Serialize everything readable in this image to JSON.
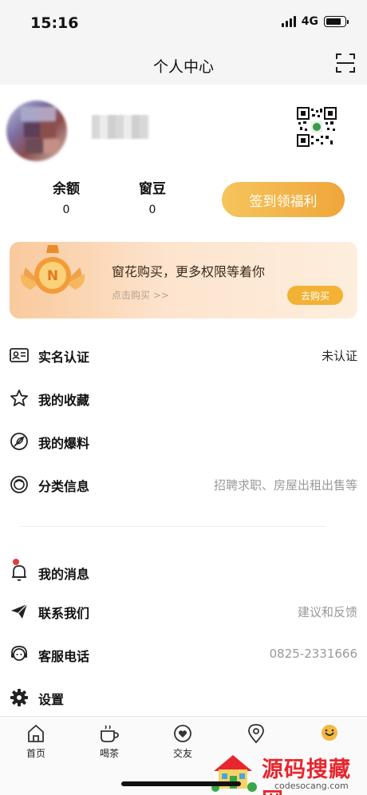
{
  "status_bar": {
    "time": "15:16",
    "network": "4G"
  },
  "header": {
    "title": "个人中心",
    "scan_icon": "scan-icon"
  },
  "profile": {
    "avatar_icon": "avatar-blurred",
    "username_icon": "username-blurred",
    "qr_icon": "qr-code-icon"
  },
  "stats": [
    {
      "label": "余额",
      "value": "0"
    },
    {
      "label": "窗豆",
      "value": "0"
    }
  ],
  "signin_button": "签到领福利",
  "vip_card": {
    "title": "窗花购买，更多权限等着你",
    "subtitle": "点击购买 >>",
    "button": "去购买",
    "medal_letter": "N"
  },
  "menu": [
    {
      "label": "实名认证",
      "value": "未认证",
      "icon": "id-card-icon"
    },
    {
      "label": "我的收藏",
      "value": "",
      "icon": "star-icon"
    },
    {
      "label": "我的爆料",
      "value": "",
      "icon": "leaf-icon"
    },
    {
      "label": "分类信息",
      "value": "招聘求职、房屋出租出售等",
      "icon": "circle-icon"
    },
    {
      "label": "我的消息",
      "value": "",
      "icon": "bell-icon"
    },
    {
      "label": "联系我们",
      "value": "建议和反馈",
      "icon": "paper-plane-icon"
    },
    {
      "label": "客服电话",
      "value": "0825-2331666",
      "icon": "headset-icon"
    },
    {
      "label": "设置",
      "value": "",
      "icon": "gear-icon"
    }
  ],
  "tabs": [
    {
      "label": "首页",
      "icon": "home-icon"
    },
    {
      "label": "喝茶",
      "icon": "cup-icon"
    },
    {
      "label": "交友",
      "icon": "heart-bubble-icon"
    },
    {
      "label": "",
      "icon": "location-icon"
    },
    {
      "label": "",
      "icon": "smile-icon"
    }
  ],
  "watermark": {
    "title": "源码搜藏网",
    "url": "codesocang.com"
  },
  "colors": {
    "accent": "#f0a63a",
    "vip_button": "#f2b234",
    "badge_dot": "#e23b3b",
    "watermark": "#e7262e"
  }
}
